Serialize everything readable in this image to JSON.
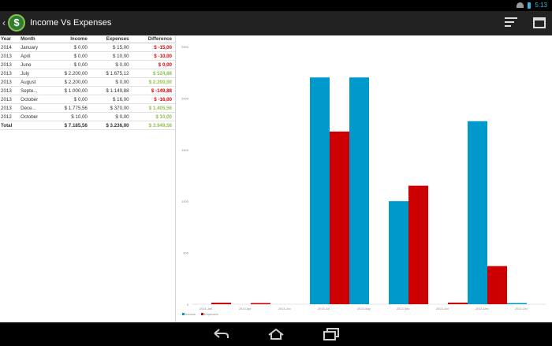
{
  "statusbar": {
    "time": "5:13"
  },
  "actionbar": {
    "title": "Income Vs Expenses",
    "logo_symbol": "$",
    "back_symbol": "‹"
  },
  "table": {
    "headers": {
      "year": "Year",
      "month": "Month",
      "income": "Income",
      "expenses": "Expenses",
      "difference": "Difference"
    },
    "rows": [
      {
        "year": "2014",
        "month": "January",
        "income": "$ 0,00",
        "expenses": "$ 15,00",
        "difference": "$ -15,00",
        "kind": "neg"
      },
      {
        "year": "2013",
        "month": "April",
        "income": "$ 0,00",
        "expenses": "$ 10,00",
        "difference": "$ -10,00",
        "kind": "neg"
      },
      {
        "year": "2013",
        "month": "June",
        "income": "$ 0,00",
        "expenses": "$ 0,00",
        "difference": "$ 0,00",
        "kind": "neg"
      },
      {
        "year": "2013",
        "month": "July",
        "income": "$ 2.200,00",
        "expenses": "$ 1.675,12",
        "difference": "$ 524,88",
        "kind": "pos"
      },
      {
        "year": "2013",
        "month": "August",
        "income": "$ 2.200,00",
        "expenses": "$ 0,00",
        "difference": "$ 2.200,00",
        "kind": "pos"
      },
      {
        "year": "2013",
        "month": "Septe...",
        "income": "$ 1.000,00",
        "expenses": "$ 1.149,88",
        "difference": "$ -149,88",
        "kind": "neg"
      },
      {
        "year": "2013",
        "month": "October",
        "income": "$ 0,00",
        "expenses": "$ 16,00",
        "difference": "$ -16,00",
        "kind": "neg"
      },
      {
        "year": "2013",
        "month": "Dece...",
        "income": "$ 1.775,56",
        "expenses": "$ 370,00",
        "difference": "$ 1.405,56",
        "kind": "pos"
      },
      {
        "year": "2012",
        "month": "October",
        "income": "$ 10,00",
        "expenses": "$ 0,00",
        "difference": "$ 10,00",
        "kind": "pos"
      }
    ],
    "total": {
      "label": "Total",
      "income": "$ 7.185,56",
      "expenses": "$ 3.236,00",
      "difference": "$ 3.949,56",
      "kind": "pos"
    }
  },
  "colors": {
    "income": "#0099cc",
    "expenses": "#cc0000",
    "positive": "#8bc34a",
    "negative": "#e00000"
  },
  "chart_data": {
    "type": "bar",
    "categories": [
      "2014-Jan",
      "2013-Apr",
      "2013-Jun",
      "2013-Jul",
      "2013-Aug",
      "2013-Sep",
      "2013-Oct",
      "2013-Dec",
      "2012-Oct"
    ],
    "series": [
      {
        "name": "Income",
        "values": [
          0,
          0,
          0,
          2200,
          2200,
          1000,
          0,
          1775.56,
          10
        ]
      },
      {
        "name": "Expenses",
        "values": [
          15,
          10,
          0,
          1675.12,
          0,
          1149.88,
          16,
          370,
          0
        ]
      }
    ],
    "ylim": [
      0,
      2500
    ],
    "yticks": [
      0,
      500,
      1000,
      1500,
      2000,
      2500
    ],
    "legend": [
      "Income",
      "Expenses"
    ],
    "legend_position": "bottom-left",
    "grid": false
  }
}
